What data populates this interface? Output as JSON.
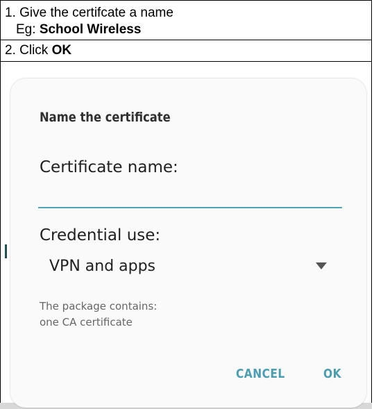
{
  "instructions": {
    "step1_prefix": "1. Give the certifcate a name",
    "step1_example_prefix": "Eg: ",
    "step1_example_value": "School Wireless",
    "step2_prefix": "2. Click ",
    "step2_value": "OK"
  },
  "dialog": {
    "title": "Name the certificate",
    "certificate_name_label": "Certificate name:",
    "certificate_name_value": "",
    "credential_use_label": "Credential use:",
    "credential_use_selected": "VPN and apps",
    "package_line1": "The package contains:",
    "package_line2": "one CA certificate",
    "cancel_label": "CANCEL",
    "ok_label": "OK"
  },
  "colors": {
    "accent": "#4a9eb3",
    "input_underline": "#4ea2b6"
  },
  "icons": {
    "dropdown": "triangle-down-icon"
  }
}
